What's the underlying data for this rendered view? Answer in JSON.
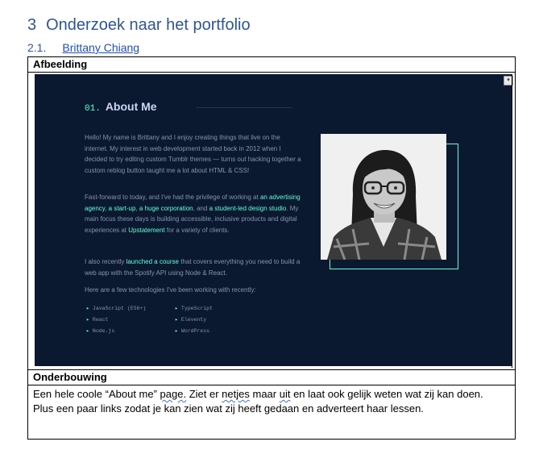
{
  "heading1": {
    "num": "3",
    "title": "Onderzoek naar het portfolio"
  },
  "heading2": {
    "num": "2.1.",
    "link": "Brittany Chiang"
  },
  "table": {
    "image_label": "Afbeelding",
    "reason_label": "Onderbouwing",
    "reason_text": {
      "p1": "Een hele coole “About me” ",
      "p2": "page.",
      "p3": " Ziet er ",
      "p4": "netjes",
      "p5": " maar ",
      "p6": "uit",
      "p7": " en laat ook gelijk weten wat zij kan doen.",
      "line2": "Plus een paar links zodat je kan zien wat zij heeft gedaan en adverteert haar lessen."
    }
  },
  "screenshot": {
    "dropdown_glyph": "▾",
    "section_num": "01.",
    "section_title": "About Me",
    "p1": "Hello! My name is Brittany and I enjoy creating things that live on the internet. My interest in web development started back in 2012 when I decided to try editing custom Tumblr themes — turns out hacking together a custom reblog button taught me a lot about HTML & CSS!",
    "p2a": "Fast-forward to today, and I've had the privilege of working at ",
    "p2b": "an advertising agency",
    "p2c": ", ",
    "p2d": "a start-up",
    "p2e": ", ",
    "p2f": "a huge corporation",
    "p2g": ", and ",
    "p2h": "a student-led design studio",
    "p2i": ". My main focus these days is building accessible, inclusive products and digital experiences at ",
    "p2j": "Upstatement",
    "p2k": " for a variety of clients.",
    "p3a": "I also recently ",
    "p3b": "launched a course",
    "p3c": " that covers everything you need to build a web app with the Spotify API using Node & React.",
    "p4": "Here are a few technologies I've been working with recently:",
    "tech": [
      "JavaScript (ES6+)",
      "TypeScript",
      "React",
      "Eleventy",
      "Node.js",
      "WordPress"
    ],
    "arrow": "▸"
  }
}
